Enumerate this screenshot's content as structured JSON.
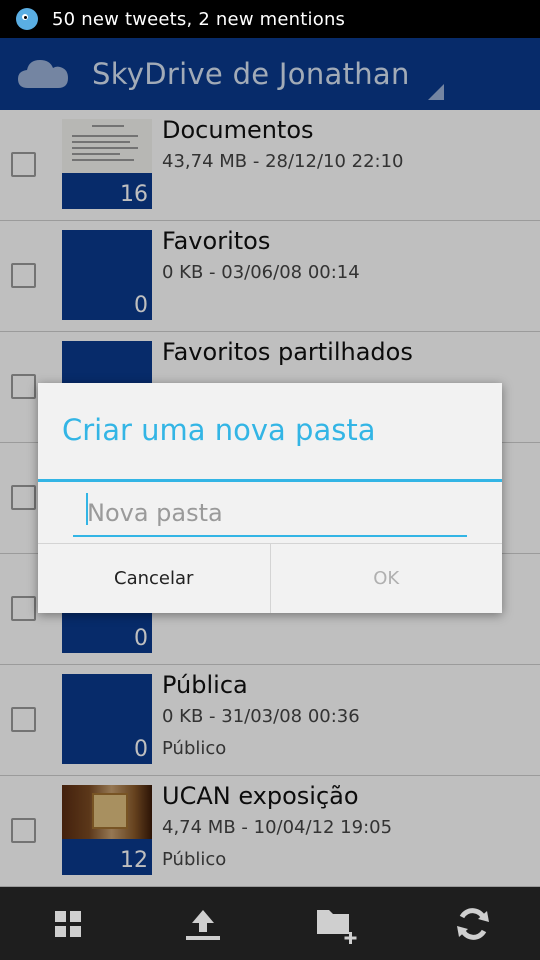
{
  "status_bar": {
    "notification_icon": "bird-icon",
    "text": "50 new tweets, 2 new mentions"
  },
  "action_bar": {
    "icon": "cloud-icon",
    "title": "SkyDrive de Jonathan"
  },
  "folders": [
    {
      "name": "Documentos",
      "meta": "43,74 MB - 28/12/10 22:10",
      "sub": "",
      "count": "16",
      "thumb": "document"
    },
    {
      "name": "Favoritos",
      "meta": "0 KB - 03/06/08 00:14",
      "sub": "",
      "count": "0",
      "thumb": "folder"
    },
    {
      "name": "Favoritos partilhados",
      "meta": "",
      "sub": "",
      "count": "",
      "thumb": "folder"
    },
    {
      "name": "",
      "meta": "",
      "sub": "",
      "count": "",
      "thumb": "folder"
    },
    {
      "name": "",
      "meta": "",
      "sub": "",
      "count": "0",
      "thumb": "folder"
    },
    {
      "name": "Pública",
      "meta": "0 KB - 31/03/08 00:36",
      "sub": "Público",
      "count": "0",
      "thumb": "folder"
    },
    {
      "name": "UCAN exposição",
      "meta": "4,74 MB - 10/04/12 19:05",
      "sub": "Público",
      "count": "12",
      "thumb": "photo"
    }
  ],
  "dialog": {
    "title": "Criar uma nova pasta",
    "input_placeholder": "Nova pasta",
    "input_value": "",
    "cancel_label": "Cancelar",
    "ok_label": "OK"
  },
  "bottom_bar": {
    "buttons": [
      {
        "icon": "grid-view-icon"
      },
      {
        "icon": "upload-icon"
      },
      {
        "icon": "new-folder-icon"
      },
      {
        "icon": "refresh-icon"
      }
    ]
  },
  "colors": {
    "accent_blue": "#0a3a8e",
    "holo_blue": "#33b5e5",
    "disabled_text": "#b0b0b0"
  }
}
